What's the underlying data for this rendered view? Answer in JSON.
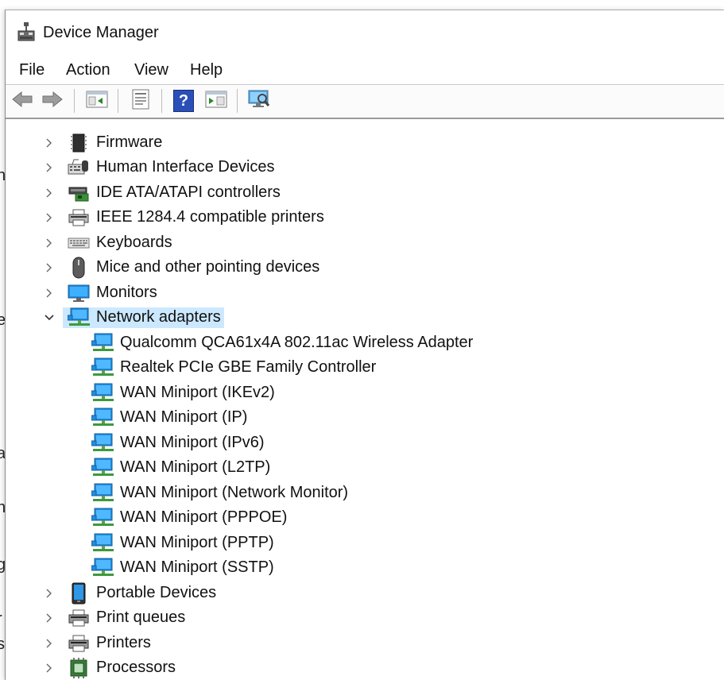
{
  "window": {
    "title": "Device Manager"
  },
  "menu": [
    "File",
    "Action",
    "View",
    "Help"
  ],
  "toolbar": {
    "back": "back-arrow-icon",
    "forward": "forward-arrow-icon",
    "show_hide": "console-tree-icon",
    "properties": "properties-icon",
    "help": "help-icon",
    "help_glyph": "?",
    "action_pane": "action-pane-icon",
    "scan": "scan-hardware-icon"
  },
  "tree": {
    "categories_before": [
      {
        "label": "Firmware",
        "icon": "firmware-icon"
      },
      {
        "label": "Human Interface Devices",
        "icon": "hid-icon"
      },
      {
        "label": "IDE ATA/ATAPI controllers",
        "icon": "ide-controller-icon"
      },
      {
        "label": "IEEE 1284.4 compatible printers",
        "icon": "printer-icon"
      },
      {
        "label": "Keyboards",
        "icon": "keyboard-icon"
      },
      {
        "label": "Mice and other pointing devices",
        "icon": "mouse-icon"
      },
      {
        "label": "Monitors",
        "icon": "monitor-icon"
      }
    ],
    "expanded": {
      "label": "Network adapters",
      "icon": "network-adapter-icon",
      "children": [
        "Qualcomm QCA61x4A 802.11ac Wireless Adapter",
        "Realtek PCIe GBE Family Controller",
        "WAN Miniport (IKEv2)",
        "WAN Miniport (IP)",
        "WAN Miniport (IPv6)",
        "WAN Miniport (L2TP)",
        "WAN Miniport (Network Monitor)",
        "WAN Miniport (PPPOE)",
        "WAN Miniport (PPTP)",
        "WAN Miniport (SSTP)"
      ]
    },
    "categories_after": [
      {
        "label": "Portable Devices",
        "icon": "portable-device-icon"
      },
      {
        "label": "Print queues",
        "icon": "print-queue-icon"
      },
      {
        "label": "Printers",
        "icon": "printer-icon"
      },
      {
        "label": "Processors",
        "icon": "processor-icon"
      }
    ]
  },
  "background_fragments": [
    "n",
    "e",
    "a",
    "n",
    "g",
    "r",
    "s"
  ]
}
